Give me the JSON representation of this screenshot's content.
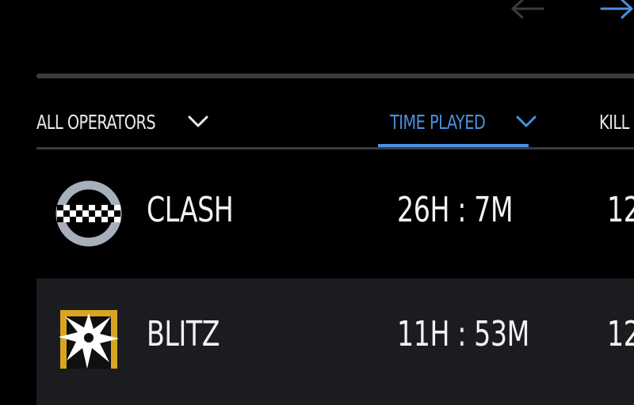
{
  "nav": {
    "prev_icon": "arrow-left-icon",
    "next_icon": "arrow-right-icon",
    "next_color": "#4a90e2",
    "prev_color": "#3a3c41"
  },
  "filter": {
    "label": "ALL OPERATORS",
    "icon": "chevron-down-icon"
  },
  "columns": {
    "sort": {
      "label": "TIME PLAYED",
      "icon": "chevron-down-icon",
      "active": true,
      "color": "#4a90e2"
    },
    "kills": {
      "label": "KILL"
    }
  },
  "operators": [
    {
      "name": "CLASH",
      "time_played": "26H : 7M",
      "kills": "12",
      "icon": "clash-operator-icon"
    },
    {
      "name": "BLITZ",
      "time_played": "11H : 53M",
      "kills": "12",
      "icon": "blitz-operator-icon"
    }
  ],
  "colors": {
    "background": "#000000",
    "row_alt": "#1b1c20",
    "divider": "#3a3c41",
    "accent": "#4a90e2",
    "text": "#f2f2f2"
  }
}
